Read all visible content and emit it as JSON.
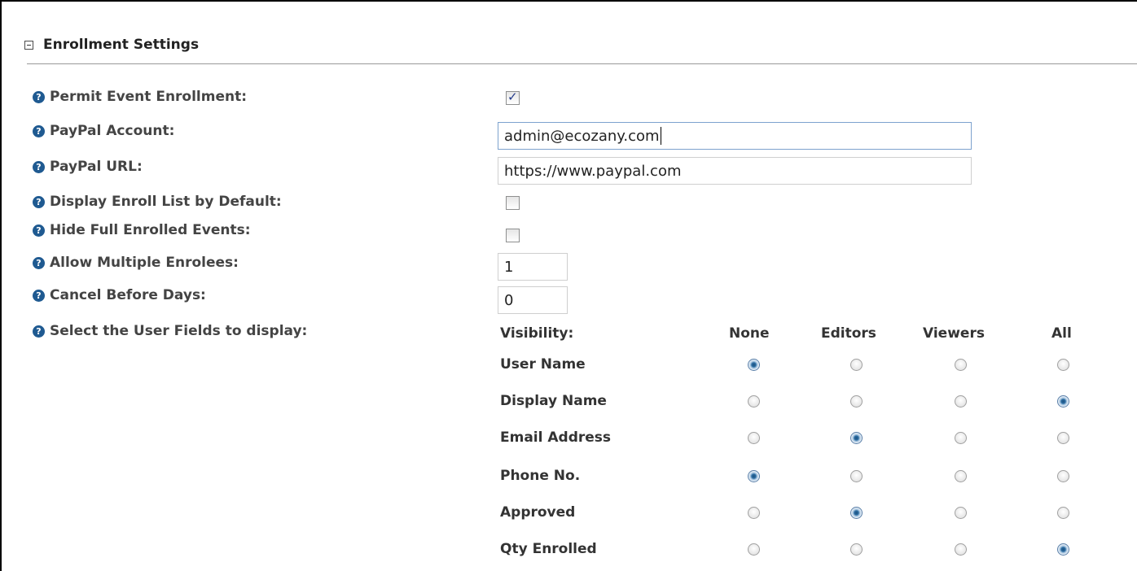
{
  "section": {
    "title": "Enrollment Settings",
    "collapse_icon": "minus-box-icon"
  },
  "fields": {
    "permit_enrollment": {
      "label": "Permit Event Enrollment:",
      "checked": true
    },
    "paypal_account": {
      "label": "PayPal Account:",
      "value": "admin@ecozany.com"
    },
    "paypal_url": {
      "label": "PayPal URL:",
      "value": "https://www.paypal.com"
    },
    "display_enroll_list": {
      "label": "Display Enroll List by Default:",
      "checked": false
    },
    "hide_full_enrolled": {
      "label": "Hide Full Enrolled Events:",
      "checked": false
    },
    "allow_multiple_enrolees": {
      "label": "Allow Multiple Enrolees:",
      "value": "1"
    },
    "cancel_before_days": {
      "label": "Cancel Before Days:",
      "value": "0"
    },
    "user_fields": {
      "label": "Select the User Fields to display:"
    }
  },
  "visibility": {
    "header": "Visibility:",
    "columns": [
      "None",
      "Editors",
      "Viewers",
      "All"
    ],
    "rows": [
      {
        "name": "User Name",
        "selected": 0
      },
      {
        "name": "Display Name",
        "selected": 3
      },
      {
        "name": "Email Address",
        "selected": 1
      },
      {
        "name": "Phone No.",
        "selected": 0
      },
      {
        "name": "Approved",
        "selected": 1
      },
      {
        "name": "Qty Enrolled",
        "selected": 3
      }
    ]
  },
  "colors": {
    "help_icon": "#1f5a91",
    "radio_selected": "#1b4f7e"
  }
}
